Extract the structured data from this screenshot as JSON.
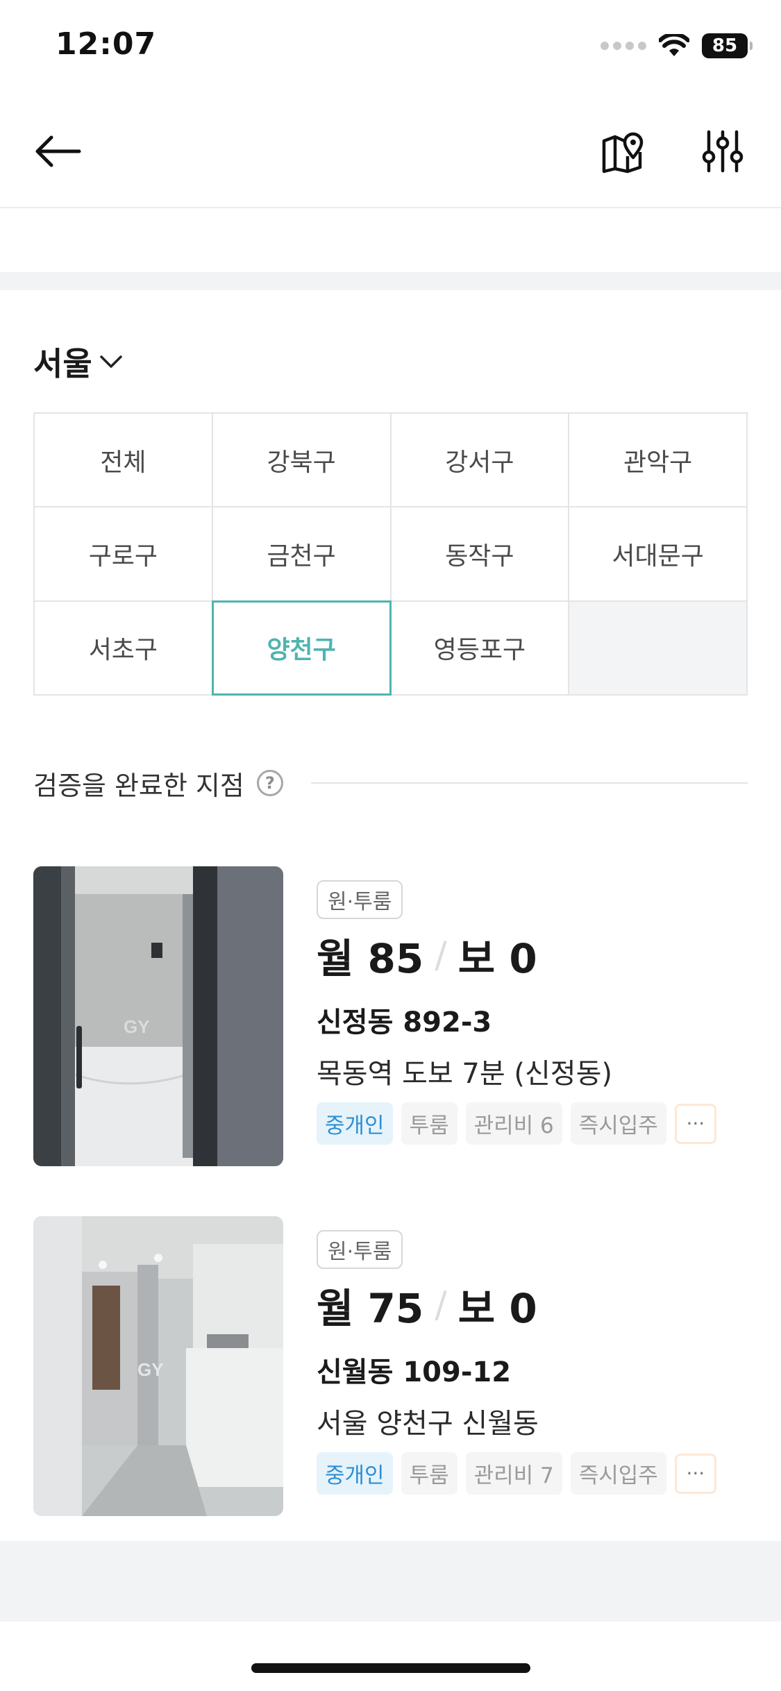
{
  "status_bar": {
    "time": "12:07",
    "battery": "85"
  },
  "nav": {
    "back_icon": "arrow-left-icon",
    "map_icon": "map-pin-icon",
    "filter_icon": "sliders-icon"
  },
  "region": {
    "name": "서울"
  },
  "districts": [
    {
      "label": "전체"
    },
    {
      "label": "강북구"
    },
    {
      "label": "강서구"
    },
    {
      "label": "관악구"
    },
    {
      "label": "구로구"
    },
    {
      "label": "금천구"
    },
    {
      "label": "동작구"
    },
    {
      "label": "서대문구"
    },
    {
      "label": "서초구"
    },
    {
      "label": "양천구",
      "selected": true
    },
    {
      "label": "영등포구"
    }
  ],
  "verified": {
    "title": "검증을 완료한 지점",
    "help": "?"
  },
  "listings": [
    {
      "type": "원·투룸",
      "monthly": "월 85",
      "deposit": "보 0",
      "address": "신정동 892-3",
      "desc": "목동역 도보 7분 (신정동)",
      "tags": [
        "중개인",
        "투룸",
        "관리비 6",
        "즉시입주"
      ],
      "more": "···"
    },
    {
      "type": "원·투룸",
      "monthly": "월 75",
      "deposit": "보 0",
      "address": "신월동 109-12",
      "desc": "서울 양천구 신월동",
      "tags": [
        "중개인",
        "투룸",
        "관리비 7",
        "즉시입주"
      ],
      "more": "···"
    }
  ],
  "colors": {
    "accent": "#4fb4b0",
    "broker_tag": "#2f8fd1"
  }
}
